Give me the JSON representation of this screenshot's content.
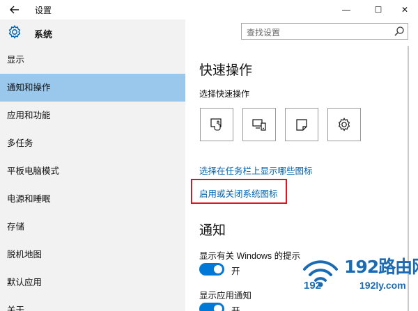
{
  "window": {
    "title": "设置",
    "back_icon": "arrow-left-icon",
    "minimize_glyph": "—",
    "maximize_glyph": "☐",
    "close_glyph": "✕"
  },
  "sidebar": {
    "header": "系统",
    "items": [
      {
        "label": "显示",
        "selected": false
      },
      {
        "label": "通知和操作",
        "selected": true
      },
      {
        "label": "应用和功能",
        "selected": false
      },
      {
        "label": "多任务",
        "selected": false
      },
      {
        "label": "平板电脑模式",
        "selected": false
      },
      {
        "label": "电源和睡眠",
        "selected": false
      },
      {
        "label": "存储",
        "selected": false
      },
      {
        "label": "脱机地图",
        "selected": false
      },
      {
        "label": "默认应用",
        "selected": false
      },
      {
        "label": "关于",
        "selected": false
      }
    ]
  },
  "search": {
    "placeholder": "查找设置"
  },
  "main": {
    "quick_actions_heading": "快速操作",
    "quick_actions_sub": "选择快速操作",
    "quick_action_tiles": [
      "tablet-mode-icon",
      "project-icon",
      "note-icon",
      "settings-gear-icon"
    ],
    "link_taskbar_icons": "选择在任务栏上显示哪些图标",
    "link_system_icons": "启用或关闭系统图标",
    "notifications_heading": "通知",
    "tips_label": "显示有关 Windows 的提示",
    "tips_toggle": "开",
    "app_notifications_label": "显示应用通知",
    "app_notifications_toggle": "开"
  },
  "watermark": {
    "brand": "192路由网",
    "number": "192",
    "url": "192ly.com"
  },
  "colors": {
    "accent": "#0078d7",
    "link": "#0063b1",
    "selected": "#99c8ec",
    "highlight": "#e0141e",
    "watermark": "#1a6bb5"
  }
}
